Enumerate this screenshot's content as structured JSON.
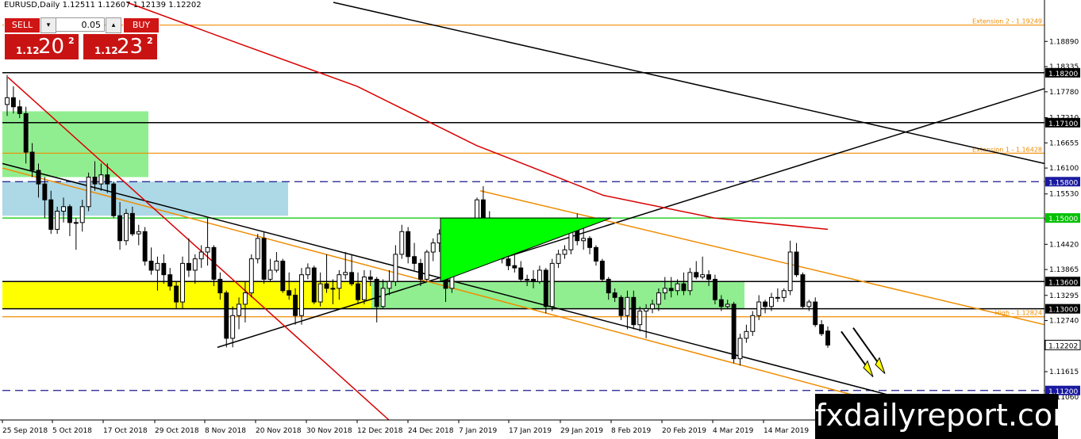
{
  "header": {
    "symbol_info": "EURUSD,Daily  1.12511 1.12607 1.12139 1.12202"
  },
  "ticket": {
    "sell_label": "SELL",
    "buy_label": "BUY",
    "lot": "0.05",
    "dropdown_glyph": "▾",
    "up_glyph": "▴",
    "sell_small": "1.12",
    "sell_big": "20",
    "sell_sup": "2",
    "buy_small": "1.12",
    "buy_big": "23",
    "buy_sup": "2"
  },
  "watermark": "fxdailyreport.com",
  "chart_data": {
    "type": "candlestick",
    "y_range": [
      1.1055,
      1.1975
    ],
    "price_ticks": [
      1.1889,
      1.18335,
      1.1778,
      1.1721,
      1.16655,
      1.161,
      1.1553,
      1.14975,
      1.1442,
      1.13865,
      1.13295,
      1.1274,
      1.11615,
      1.1106
    ],
    "x_labels": [
      "25 Sep 2018",
      "5 Oct 2018",
      "17 Oct 2018",
      "29 Oct 2018",
      "8 Nov 2018",
      "20 Nov 2018",
      "30 Nov 2018",
      "12 Dec 2018",
      "24 Dec 2018",
      "7 Jan 2019",
      "17 Jan 2019",
      "29 Jan 2019",
      "8 Feb 2019",
      "20 Feb 2019",
      "4 Mar 2019",
      "14 Mar 2019"
    ],
    "horizontal_levels": [
      {
        "value": 1.19249,
        "color": "#f08c00",
        "style": "solid",
        "label": "Extension 2 - 1.19249",
        "badge": ""
      },
      {
        "value": 1.182,
        "color": "#000000",
        "style": "solid",
        "label": "",
        "badge": "1.18200"
      },
      {
        "value": 1.171,
        "color": "#000000",
        "style": "solid",
        "label": "",
        "badge": "1.17100"
      },
      {
        "value": 1.16428,
        "color": "#f08c00",
        "style": "solid",
        "label": "Extension 1 - 1.16428",
        "badge": ""
      },
      {
        "value": 1.158,
        "color": "#1a1a8c",
        "style": "dashed",
        "label": "",
        "badge": "1.15800"
      },
      {
        "value": 1.15,
        "color": "#00c800",
        "style": "solid",
        "label": "",
        "badge": "1.15000"
      },
      {
        "value": 1.136,
        "color": "#000000",
        "style": "solid",
        "label": "",
        "badge": "1.13600"
      },
      {
        "value": 1.13,
        "color": "#000000",
        "style": "solid",
        "label": "",
        "badge": "1.13000"
      },
      {
        "value": 1.12824,
        "color": "#f08c00",
        "style": "solid",
        "label": "High - 1.12824",
        "badge": ""
      },
      {
        "value": 1.112,
        "color": "#1a1a8c",
        "style": "dashed",
        "label": "",
        "badge": "1.11200"
      }
    ],
    "current_price": {
      "value": 1.12202,
      "badge": "1.12202"
    },
    "candles": [
      {
        "date": "2018-09-24",
        "o": 1.175,
        "h": 1.1815,
        "l": 1.1725,
        "c": 1.1765
      },
      {
        "date": "2018-09-25",
        "o": 1.1765,
        "h": 1.179,
        "l": 1.173,
        "c": 1.1745
      },
      {
        "date": "2018-09-26",
        "o": 1.1745,
        "h": 1.176,
        "l": 1.172,
        "c": 1.173
      },
      {
        "date": "2018-09-27",
        "o": 1.173,
        "h": 1.1745,
        "l": 1.162,
        "c": 1.1645
      },
      {
        "date": "2018-09-28",
        "o": 1.1645,
        "h": 1.1665,
        "l": 1.159,
        "c": 1.1605
      },
      {
        "date": "2018-10-01",
        "o": 1.1605,
        "h": 1.162,
        "l": 1.1545,
        "c": 1.1575
      },
      {
        "date": "2018-10-02",
        "o": 1.1575,
        "h": 1.159,
        "l": 1.15,
        "c": 1.154
      },
      {
        "date": "2018-10-03",
        "o": 1.154,
        "h": 1.156,
        "l": 1.1465,
        "c": 1.1475
      },
      {
        "date": "2018-10-04",
        "o": 1.1475,
        "h": 1.1525,
        "l": 1.1465,
        "c": 1.1515
      },
      {
        "date": "2018-10-05",
        "o": 1.1515,
        "h": 1.1545,
        "l": 1.149,
        "c": 1.1525
      },
      {
        "date": "2018-10-08",
        "o": 1.1525,
        "h": 1.153,
        "l": 1.146,
        "c": 1.149
      },
      {
        "date": "2018-10-09",
        "o": 1.149,
        "h": 1.15,
        "l": 1.143,
        "c": 1.149
      },
      {
        "date": "2018-10-10",
        "o": 1.149,
        "h": 1.154,
        "l": 1.147,
        "c": 1.1525
      },
      {
        "date": "2018-10-11",
        "o": 1.1525,
        "h": 1.16,
        "l": 1.1515,
        "c": 1.159
      },
      {
        "date": "2018-10-12",
        "o": 1.159,
        "h": 1.1625,
        "l": 1.156,
        "c": 1.1575
      },
      {
        "date": "2018-10-15",
        "o": 1.1575,
        "h": 1.162,
        "l": 1.156,
        "c": 1.1595
      },
      {
        "date": "2018-10-16",
        "o": 1.1595,
        "h": 1.162,
        "l": 1.1555,
        "c": 1.1575
      },
      {
        "date": "2018-10-17",
        "o": 1.1575,
        "h": 1.158,
        "l": 1.15,
        "c": 1.1505
      },
      {
        "date": "2018-10-18",
        "o": 1.1505,
        "h": 1.1535,
        "l": 1.143,
        "c": 1.145
      },
      {
        "date": "2018-10-19",
        "o": 1.145,
        "h": 1.152,
        "l": 1.144,
        "c": 1.151
      },
      {
        "date": "2018-10-22",
        "o": 1.151,
        "h": 1.1525,
        "l": 1.146,
        "c": 1.1465
      },
      {
        "date": "2018-10-23",
        "o": 1.1465,
        "h": 1.1485,
        "l": 1.144,
        "c": 1.147
      },
      {
        "date": "2018-10-24",
        "o": 1.147,
        "h": 1.148,
        "l": 1.1395,
        "c": 1.1405
      },
      {
        "date": "2018-10-25",
        "o": 1.1405,
        "h": 1.1435,
        "l": 1.1375,
        "c": 1.1385
      },
      {
        "date": "2018-10-26",
        "o": 1.1385,
        "h": 1.1415,
        "l": 1.134,
        "c": 1.14
      },
      {
        "date": "2018-10-29",
        "o": 1.14,
        "h": 1.142,
        "l": 1.1355,
        "c": 1.1375
      },
      {
        "date": "2018-10-30",
        "o": 1.1375,
        "h": 1.139,
        "l": 1.134,
        "c": 1.135
      },
      {
        "date": "2018-10-31",
        "o": 1.135,
        "h": 1.136,
        "l": 1.13,
        "c": 1.1315
      },
      {
        "date": "2018-11-01",
        "o": 1.1315,
        "h": 1.1415,
        "l": 1.13,
        "c": 1.14
      },
      {
        "date": "2018-11-02",
        "o": 1.14,
        "h": 1.1455,
        "l": 1.137,
        "c": 1.1385
      },
      {
        "date": "2018-11-05",
        "o": 1.1385,
        "h": 1.142,
        "l": 1.1355,
        "c": 1.141
      },
      {
        "date": "2018-11-06",
        "o": 1.141,
        "h": 1.144,
        "l": 1.139,
        "c": 1.1425
      },
      {
        "date": "2018-11-07",
        "o": 1.1425,
        "h": 1.15,
        "l": 1.1395,
        "c": 1.1435
      },
      {
        "date": "2018-11-08",
        "o": 1.1435,
        "h": 1.144,
        "l": 1.135,
        "c": 1.1365
      },
      {
        "date": "2018-11-09",
        "o": 1.1365,
        "h": 1.138,
        "l": 1.132,
        "c": 1.1335
      },
      {
        "date": "2018-11-12",
        "o": 1.1335,
        "h": 1.134,
        "l": 1.1215,
        "c": 1.1235
      },
      {
        "date": "2018-11-13",
        "o": 1.1235,
        "h": 1.1305,
        "l": 1.1215,
        "c": 1.1285
      },
      {
        "date": "2018-11-14",
        "o": 1.1285,
        "h": 1.1325,
        "l": 1.1255,
        "c": 1.131
      },
      {
        "date": "2018-11-15",
        "o": 1.131,
        "h": 1.136,
        "l": 1.127,
        "c": 1.1335
      },
      {
        "date": "2018-11-16",
        "o": 1.1335,
        "h": 1.142,
        "l": 1.1325,
        "c": 1.141
      },
      {
        "date": "2018-11-19",
        "o": 1.141,
        "h": 1.1465,
        "l": 1.14,
        "c": 1.1455
      },
      {
        "date": "2018-11-20",
        "o": 1.1455,
        "h": 1.147,
        "l": 1.1355,
        "c": 1.1365
      },
      {
        "date": "2018-11-21",
        "o": 1.1365,
        "h": 1.141,
        "l": 1.136,
        "c": 1.1385
      },
      {
        "date": "2018-11-22",
        "o": 1.1385,
        "h": 1.1425,
        "l": 1.138,
        "c": 1.1405
      },
      {
        "date": "2018-11-23",
        "o": 1.1405,
        "h": 1.141,
        "l": 1.1335,
        "c": 1.134
      },
      {
        "date": "2018-11-26",
        "o": 1.134,
        "h": 1.138,
        "l": 1.132,
        "c": 1.133
      },
      {
        "date": "2018-11-27",
        "o": 1.133,
        "h": 1.1345,
        "l": 1.1265,
        "c": 1.1285
      },
      {
        "date": "2018-11-28",
        "o": 1.1285,
        "h": 1.139,
        "l": 1.1265,
        "c": 1.1375
      },
      {
        "date": "2018-11-29",
        "o": 1.1375,
        "h": 1.14,
        "l": 1.1365,
        "c": 1.139
      },
      {
        "date": "2018-11-30",
        "o": 1.139,
        "h": 1.1395,
        "l": 1.131,
        "c": 1.1315
      },
      {
        "date": "2018-12-03",
        "o": 1.1315,
        "h": 1.138,
        "l": 1.1305,
        "c": 1.1355
      },
      {
        "date": "2018-12-04",
        "o": 1.1355,
        "h": 1.142,
        "l": 1.1335,
        "c": 1.1345
      },
      {
        "date": "2018-12-05",
        "o": 1.1345,
        "h": 1.1365,
        "l": 1.131,
        "c": 1.1345
      },
      {
        "date": "2018-12-06",
        "o": 1.1345,
        "h": 1.1385,
        "l": 1.132,
        "c": 1.1375
      },
      {
        "date": "2018-12-07",
        "o": 1.1375,
        "h": 1.1425,
        "l": 1.1365,
        "c": 1.138
      },
      {
        "date": "2018-12-10",
        "o": 1.138,
        "h": 1.142,
        "l": 1.135,
        "c": 1.1355
      },
      {
        "date": "2018-12-11",
        "o": 1.1355,
        "h": 1.138,
        "l": 1.131,
        "c": 1.132
      },
      {
        "date": "2018-12-12",
        "o": 1.132,
        "h": 1.1385,
        "l": 1.131,
        "c": 1.137
      },
      {
        "date": "2018-12-13",
        "o": 1.137,
        "h": 1.1385,
        "l": 1.135,
        "c": 1.1365
      },
      {
        "date": "2018-12-14",
        "o": 1.1365,
        "h": 1.137,
        "l": 1.127,
        "c": 1.1305
      },
      {
        "date": "2018-12-17",
        "o": 1.1305,
        "h": 1.1365,
        "l": 1.13,
        "c": 1.1345
      },
      {
        "date": "2018-12-18",
        "o": 1.1345,
        "h": 1.1385,
        "l": 1.133,
        "c": 1.136
      },
      {
        "date": "2018-12-19",
        "o": 1.136,
        "h": 1.144,
        "l": 1.135,
        "c": 1.142
      },
      {
        "date": "2018-12-20",
        "o": 1.142,
        "h": 1.1485,
        "l": 1.141,
        "c": 1.147
      },
      {
        "date": "2018-12-21",
        "o": 1.147,
        "h": 1.148,
        "l": 1.14,
        "c": 1.1415
      },
      {
        "date": "2018-12-24",
        "o": 1.1415,
        "h": 1.1445,
        "l": 1.1385,
        "c": 1.14
      },
      {
        "date": "2018-12-26",
        "o": 1.14,
        "h": 1.141,
        "l": 1.135,
        "c": 1.1365
      },
      {
        "date": "2018-12-27",
        "o": 1.1365,
        "h": 1.143,
        "l": 1.136,
        "c": 1.1425
      },
      {
        "date": "2018-12-28",
        "o": 1.1425,
        "h": 1.1455,
        "l": 1.1405,
        "c": 1.1445
      },
      {
        "date": "2018-12-31",
        "o": 1.1445,
        "h": 1.1475,
        "l": 1.1425,
        "c": 1.1465
      },
      {
        "date": "2019-01-02",
        "o": 1.1465,
        "h": 1.1495,
        "l": 1.1315,
        "c": 1.1345
      },
      {
        "date": "2019-01-03",
        "o": 1.1345,
        "h": 1.141,
        "l": 1.1335,
        "c": 1.1395
      },
      {
        "date": "2019-01-04",
        "o": 1.1395,
        "h": 1.142,
        "l": 1.1375,
        "c": 1.1405
      },
      {
        "date": "2019-01-07",
        "o": 1.1405,
        "h": 1.148,
        "l": 1.14,
        "c": 1.147
      },
      {
        "date": "2019-01-08",
        "o": 1.147,
        "h": 1.1485,
        "l": 1.142,
        "c": 1.144
      },
      {
        "date": "2019-01-09",
        "o": 1.144,
        "h": 1.1545,
        "l": 1.1435,
        "c": 1.154
      },
      {
        "date": "2019-01-10",
        "o": 1.154,
        "h": 1.157,
        "l": 1.1485,
        "c": 1.15
      },
      {
        "date": "2019-01-11",
        "o": 1.15,
        "h": 1.1515,
        "l": 1.1455,
        "c": 1.1465
      },
      {
        "date": "2019-01-14",
        "o": 1.1465,
        "h": 1.1495,
        "l": 1.144,
        "c": 1.147
      },
      {
        "date": "2019-01-15",
        "o": 1.147,
        "h": 1.1485,
        "l": 1.14,
        "c": 1.141
      },
      {
        "date": "2019-01-16",
        "o": 1.141,
        "h": 1.1425,
        "l": 1.1385,
        "c": 1.1395
      },
      {
        "date": "2019-01-17",
        "o": 1.1395,
        "h": 1.142,
        "l": 1.138,
        "c": 1.139
      },
      {
        "date": "2019-01-18",
        "o": 1.139,
        "h": 1.1405,
        "l": 1.136,
        "c": 1.1365
      },
      {
        "date": "2019-01-21",
        "o": 1.1365,
        "h": 1.1375,
        "l": 1.135,
        "c": 1.1365
      },
      {
        "date": "2019-01-22",
        "o": 1.1365,
        "h": 1.1385,
        "l": 1.1345,
        "c": 1.136
      },
      {
        "date": "2019-01-23",
        "o": 1.136,
        "h": 1.1395,
        "l": 1.1355,
        "c": 1.1385
      },
      {
        "date": "2019-01-24",
        "o": 1.1385,
        "h": 1.139,
        "l": 1.129,
        "c": 1.1305
      },
      {
        "date": "2019-01-25",
        "o": 1.1305,
        "h": 1.141,
        "l": 1.1295,
        "c": 1.14
      },
      {
        "date": "2019-01-28",
        "o": 1.14,
        "h": 1.143,
        "l": 1.139,
        "c": 1.142
      },
      {
        "date": "2019-01-29",
        "o": 1.142,
        "h": 1.144,
        "l": 1.141,
        "c": 1.143
      },
      {
        "date": "2019-01-30",
        "o": 1.143,
        "h": 1.1485,
        "l": 1.142,
        "c": 1.1475
      },
      {
        "date": "2019-01-31",
        "o": 1.1475,
        "h": 1.151,
        "l": 1.144,
        "c": 1.145
      },
      {
        "date": "2019-02-01",
        "o": 1.145,
        "h": 1.1485,
        "l": 1.143,
        "c": 1.1455
      },
      {
        "date": "2019-02-04",
        "o": 1.1455,
        "h": 1.146,
        "l": 1.142,
        "c": 1.1435
      },
      {
        "date": "2019-02-05",
        "o": 1.1435,
        "h": 1.144,
        "l": 1.1395,
        "c": 1.1405
      },
      {
        "date": "2019-02-06",
        "o": 1.1405,
        "h": 1.141,
        "l": 1.136,
        "c": 1.1365
      },
      {
        "date": "2019-02-07",
        "o": 1.1365,
        "h": 1.137,
        "l": 1.132,
        "c": 1.1335
      },
      {
        "date": "2019-02-08",
        "o": 1.1335,
        "h": 1.1345,
        "l": 1.1315,
        "c": 1.1325
      },
      {
        "date": "2019-02-11",
        "o": 1.1325,
        "h": 1.133,
        "l": 1.1275,
        "c": 1.1285
      },
      {
        "date": "2019-02-12",
        "o": 1.1285,
        "h": 1.134,
        "l": 1.1255,
        "c": 1.1325
      },
      {
        "date": "2019-02-13",
        "o": 1.1325,
        "h": 1.134,
        "l": 1.1255,
        "c": 1.1265
      },
      {
        "date": "2019-02-14",
        "o": 1.1265,
        "h": 1.1305,
        "l": 1.125,
        "c": 1.1295
      },
      {
        "date": "2019-02-15",
        "o": 1.1295,
        "h": 1.131,
        "l": 1.1235,
        "c": 1.13
      },
      {
        "date": "2019-02-18",
        "o": 1.13,
        "h": 1.132,
        "l": 1.129,
        "c": 1.131
      },
      {
        "date": "2019-02-19",
        "o": 1.131,
        "h": 1.1345,
        "l": 1.1295,
        "c": 1.1335
      },
      {
        "date": "2019-02-20",
        "o": 1.1335,
        "h": 1.137,
        "l": 1.132,
        "c": 1.1345
      },
      {
        "date": "2019-02-21",
        "o": 1.1345,
        "h": 1.137,
        "l": 1.1325,
        "c": 1.134
      },
      {
        "date": "2019-02-22",
        "o": 1.134,
        "h": 1.1365,
        "l": 1.133,
        "c": 1.1355
      },
      {
        "date": "2019-02-25",
        "o": 1.1355,
        "h": 1.138,
        "l": 1.133,
        "c": 1.134
      },
      {
        "date": "2019-02-26",
        "o": 1.134,
        "h": 1.139,
        "l": 1.133,
        "c": 1.138
      },
      {
        "date": "2019-02-27",
        "o": 1.138,
        "h": 1.1405,
        "l": 1.1365,
        "c": 1.137
      },
      {
        "date": "2019-02-28",
        "o": 1.137,
        "h": 1.1415,
        "l": 1.1365,
        "c": 1.1375
      },
      {
        "date": "2019-03-01",
        "o": 1.1375,
        "h": 1.1385,
        "l": 1.135,
        "c": 1.1365
      },
      {
        "date": "2019-03-04",
        "o": 1.1365,
        "h": 1.1375,
        "l": 1.131,
        "c": 1.132
      },
      {
        "date": "2019-03-05",
        "o": 1.132,
        "h": 1.133,
        "l": 1.1295,
        "c": 1.1305
      },
      {
        "date": "2019-03-06",
        "o": 1.1305,
        "h": 1.132,
        "l": 1.13,
        "c": 1.131
      },
      {
        "date": "2019-03-07",
        "o": 1.131,
        "h": 1.1315,
        "l": 1.118,
        "c": 1.119
      },
      {
        "date": "2019-03-08",
        "o": 1.119,
        "h": 1.1245,
        "l": 1.1175,
        "c": 1.1235
      },
      {
        "date": "2019-03-11",
        "o": 1.1235,
        "h": 1.1265,
        "l": 1.1225,
        "c": 1.125
      },
      {
        "date": "2019-03-12",
        "o": 1.125,
        "h": 1.1295,
        "l": 1.124,
        "c": 1.1285
      },
      {
        "date": "2019-03-13",
        "o": 1.1285,
        "h": 1.133,
        "l": 1.1275,
        "c": 1.1315
      },
      {
        "date": "2019-03-14",
        "o": 1.1315,
        "h": 1.132,
        "l": 1.129,
        "c": 1.1305
      },
      {
        "date": "2019-03-15",
        "o": 1.1305,
        "h": 1.1335,
        "l": 1.1295,
        "c": 1.1325
      },
      {
        "date": "2019-03-18",
        "o": 1.1325,
        "h": 1.1345,
        "l": 1.1315,
        "c": 1.1325
      },
      {
        "date": "2019-03-19",
        "o": 1.1325,
        "h": 1.1345,
        "l": 1.1315,
        "c": 1.134
      },
      {
        "date": "2019-03-20",
        "o": 1.134,
        "h": 1.145,
        "l": 1.133,
        "c": 1.1425
      },
      {
        "date": "2019-03-21",
        "o": 1.1425,
        "h": 1.1445,
        "l": 1.137,
        "c": 1.1375
      },
      {
        "date": "2019-03-22",
        "o": 1.1375,
        "h": 1.138,
        "l": 1.13,
        "c": 1.1305
      },
      {
        "date": "2019-03-25",
        "o": 1.1305,
        "h": 1.132,
        "l": 1.1295,
        "c": 1.1315
      },
      {
        "date": "2019-03-26",
        "o": 1.1315,
        "h": 1.1325,
        "l": 1.126,
        "c": 1.1265
      },
      {
        "date": "2019-03-27",
        "o": 1.1265,
        "h": 1.1275,
        "l": 1.124,
        "c": 1.1245
      },
      {
        "date": "2019-03-28",
        "o": 1.1251,
        "h": 1.1261,
        "l": 1.1214,
        "c": 1.122
      }
    ],
    "colors": {
      "bull": "#ffffff",
      "bear": "#000000",
      "ma": "#d80000",
      "trend": "#000000",
      "channel": "#f08c00",
      "red_trend": "#d80000",
      "zone_green": "#90ee90",
      "zone_blue": "#add8e6",
      "zone_yellow": "#ffff00",
      "triangle": "#00ff00",
      "arrow": "#ffff00"
    }
  }
}
